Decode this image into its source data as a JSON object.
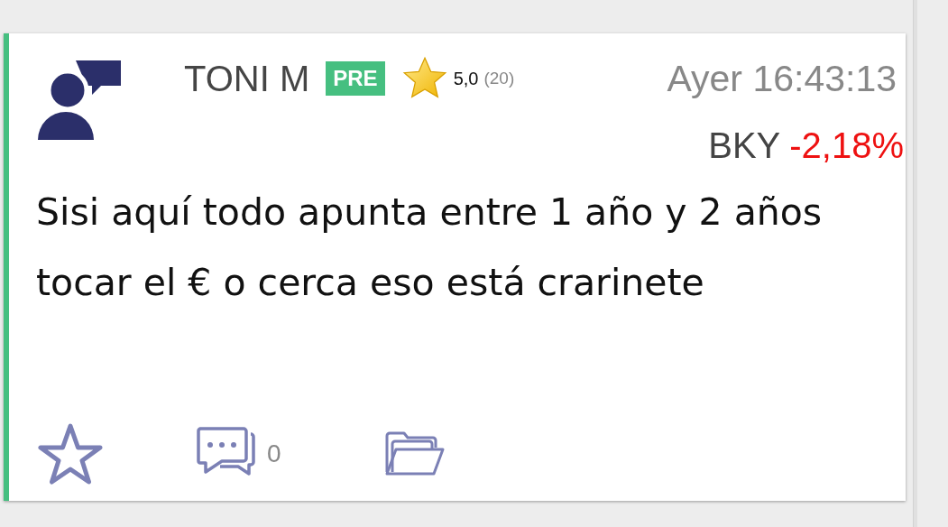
{
  "post": {
    "author": "TONI M",
    "badge": "PRE",
    "rating": "5,0",
    "rating_count": "(20)",
    "time": "Ayer 16:43:13",
    "ticker": "BKY",
    "change": "-2,18%",
    "message": "Sisi aquí todo apunta entre 1 año y 2 años tocar el € o cerca eso está crarinete",
    "favorite": false,
    "comment_count": "0"
  }
}
